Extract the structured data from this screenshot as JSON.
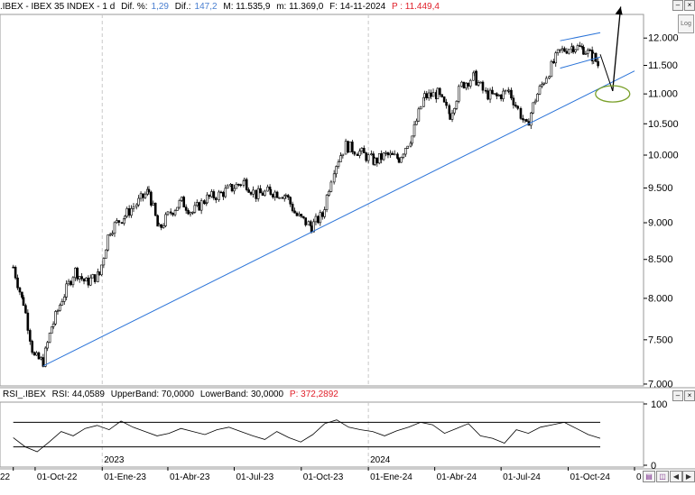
{
  "header": {
    "symbol_label": ".IBEX - IBEX 35 INDEX - 1 d",
    "dif_pct_label": "Dif. %:",
    "dif_pct_value": "1,29",
    "dif_label": "Dif.:",
    "dif_value": "147,2",
    "max_label": "M: 11.535,9",
    "min_label": "m: 11.369,0",
    "date_label": "F: 14-11-2024",
    "price_label": "P : 11.449,4"
  },
  "rsi_header": {
    "name": "RSI_.IBEX",
    "rsi": "RSI: 44,0589",
    "upper": "UpperBand: 70,0000",
    "lower": "LowerBand: 30,0000",
    "price": "P: 372,2892"
  },
  "controls": {
    "log_label": "Log",
    "close_glyph": "×",
    "min_glyph": "–"
  },
  "colors": {
    "up": "#000000",
    "down": "#000000",
    "trendline": "#2a73d8",
    "ellipse": "#7aa02a",
    "overbought": "#2a73d8",
    "oversold": "#e0202a",
    "grid": "#c8c8c8"
  },
  "chart_data": [
    {
      "type": "candlestick",
      "title": ".IBEX - IBEX 35 INDEX - 1 d",
      "y_scale": "log",
      "y_ticks": [
        "12.000",
        "11.500",
        "11.000",
        "10.500",
        "10.000",
        "9.500",
        "9.000",
        "8.500",
        "8.000",
        "7.500",
        "7.000"
      ],
      "y_tick_values": [
        12000,
        11500,
        11000,
        10500,
        10000,
        9500,
        9000,
        8500,
        8000,
        7500,
        7000
      ],
      "ylim": [
        6980,
        12450
      ],
      "x_ticks": [
        "22",
        "01-Oct-22",
        "01-Ene-23",
        "01-Abr-23",
        "01-Jul-23",
        "01-Oct-23",
        "01-Ene-24",
        "01-Abr-24",
        "01-Jul-24",
        "01-Oct-24",
        "0"
      ],
      "year_labels": [
        "2023",
        "2024"
      ],
      "series_close": [
        [
          "2022-09-01",
          8400
        ],
        [
          "2022-09-15",
          7950
        ],
        [
          "2022-09-30",
          7300
        ],
        [
          "2022-10-12",
          7250
        ],
        [
          "2022-10-26",
          7700
        ],
        [
          "2022-11-10",
          8050
        ],
        [
          "2022-11-25",
          8350
        ],
        [
          "2022-12-10",
          8200
        ],
        [
          "2022-12-28",
          8300
        ],
        [
          "2023-01-12",
          8900
        ],
        [
          "2023-02-01",
          9100
        ],
        [
          "2023-02-20",
          9300
        ],
        [
          "2023-03-06",
          9450
        ],
        [
          "2023-03-20",
          8900
        ],
        [
          "2023-04-05",
          9150
        ],
        [
          "2023-04-20",
          9300
        ],
        [
          "2023-05-05",
          9150
        ],
        [
          "2023-05-25",
          9350
        ],
        [
          "2023-06-10",
          9400
        ],
        [
          "2023-06-28",
          9500
        ],
        [
          "2023-07-15",
          9600
        ],
        [
          "2023-07-31",
          9400
        ],
        [
          "2023-08-20",
          9450
        ],
        [
          "2023-09-10",
          9400
        ],
        [
          "2023-09-25",
          9100
        ],
        [
          "2023-10-15",
          8950
        ],
        [
          "2023-10-30",
          9100
        ],
        [
          "2023-11-15",
          9800
        ],
        [
          "2023-12-01",
          10150
        ],
        [
          "2023-12-20",
          10050
        ],
        [
          "2024-01-10",
          9900
        ],
        [
          "2024-01-25",
          10000
        ],
        [
          "2024-02-12",
          9950
        ],
        [
          "2024-03-01",
          10300
        ],
        [
          "2024-03-18",
          10950
        ],
        [
          "2024-04-05",
          11000
        ],
        [
          "2024-04-22",
          10650
        ],
        [
          "2024-05-08",
          11150
        ],
        [
          "2024-05-25",
          11300
        ],
        [
          "2024-06-10",
          11000
        ],
        [
          "2024-06-25",
          10950
        ],
        [
          "2024-07-12",
          11050
        ],
        [
          "2024-08-05",
          10450
        ],
        [
          "2024-08-20",
          11000
        ],
        [
          "2024-09-05",
          11400
        ],
        [
          "2024-09-20",
          11750
        ],
        [
          "2024-10-08",
          11850
        ],
        [
          "2024-10-22",
          11800
        ],
        [
          "2024-11-05",
          11650
        ],
        [
          "2024-11-14",
          11449.4
        ]
      ],
      "annotations": [
        {
          "kind": "trendline",
          "from": [
            "2022-10-12",
            7200
          ],
          "to": [
            "2024-12-31",
            11400
          ]
        },
        {
          "kind": "channel_upper",
          "from": [
            "2024-09-20",
            11950
          ],
          "to": [
            "2024-11-14",
            12100
          ]
        },
        {
          "kind": "channel_lower",
          "from": [
            "2024-09-20",
            11450
          ],
          "to": [
            "2024-11-14",
            11650
          ]
        },
        {
          "kind": "arrow_down",
          "from": [
            "2024-11-14",
            11700
          ],
          "to": [
            "2024-12-01",
            11050
          ]
        },
        {
          "kind": "arrow_up",
          "from": [
            "2024-12-01",
            11050
          ],
          "to": [
            "2024-12-12",
            12600
          ]
        },
        {
          "kind": "ellipse",
          "center": [
            "2024-12-01",
            11000
          ]
        }
      ]
    },
    {
      "type": "line",
      "title": "RSI_.IBEX",
      "ylim": [
        0,
        100
      ],
      "y_ticks": [
        "100",
        "0"
      ],
      "y_tick_values": [
        100,
        0
      ],
      "bands": [
        70,
        30
      ],
      "series": [
        {
          "name": "RSI",
          "values": [
            45,
            30,
            22,
            38,
            55,
            48,
            60,
            65,
            58,
            72,
            62,
            55,
            48,
            52,
            60,
            55,
            50,
            58,
            62,
            55,
            48,
            42,
            55,
            45,
            38,
            50,
            68,
            74,
            62,
            58,
            55,
            48,
            56,
            62,
            70,
            66,
            52,
            60,
            68,
            48,
            44,
            36,
            58,
            52,
            62,
            66,
            70,
            60,
            50,
            44
          ]
        }
      ]
    }
  ]
}
